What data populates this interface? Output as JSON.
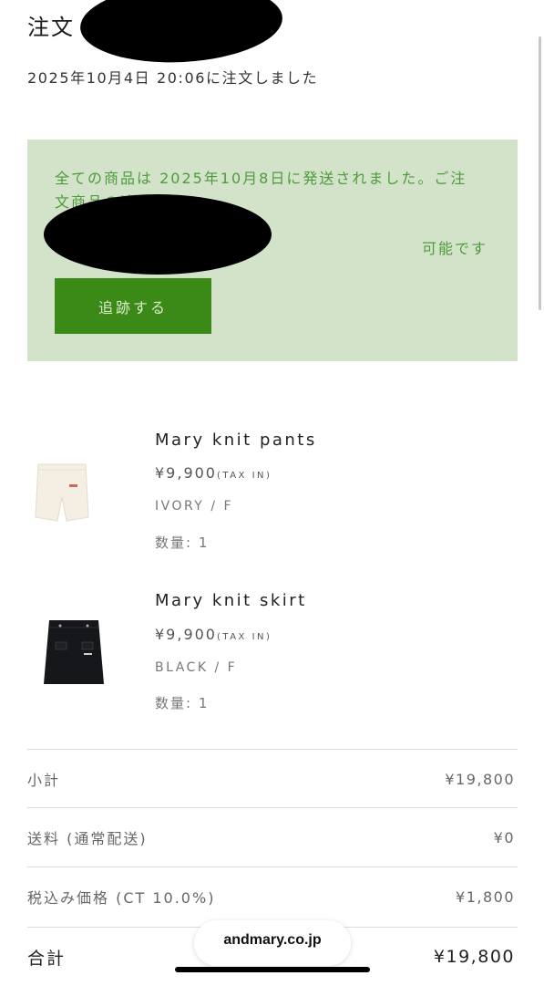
{
  "header": {
    "title": "注文",
    "order_date": "2025年10月4日 20:06に注文しました"
  },
  "shipping": {
    "message": "全ての商品は 2025年10月8日に発送されました。ご注文商品の追跡は",
    "possible": "可能です",
    "track_button": "追跡する"
  },
  "products": [
    {
      "name": "Mary knit pants",
      "price": "¥9,900",
      "tax": "(TAX IN)",
      "variant": "IVORY / F",
      "qty": "数量: 1"
    },
    {
      "name": "Mary knit skirt",
      "price": "¥9,900",
      "tax": "(TAX IN)",
      "variant": "BLACK / F",
      "qty": "数量: 1"
    }
  ],
  "summary": {
    "subtotal_label": "小計",
    "subtotal_value": "¥19,800",
    "shipping_label": "送料 (通常配送)",
    "shipping_value": "¥0",
    "tax_label": "税込み価格 (CT 10.0%)",
    "tax_value": "¥1,800",
    "total_label": "合計",
    "total_value": "¥19,800"
  },
  "browser": {
    "url": "andmary.co.jp"
  },
  "colors": {
    "ship_box_bg": "#d2e3c9",
    "ship_text": "#4f9a3c",
    "track_button_bg": "#3b8a18"
  }
}
